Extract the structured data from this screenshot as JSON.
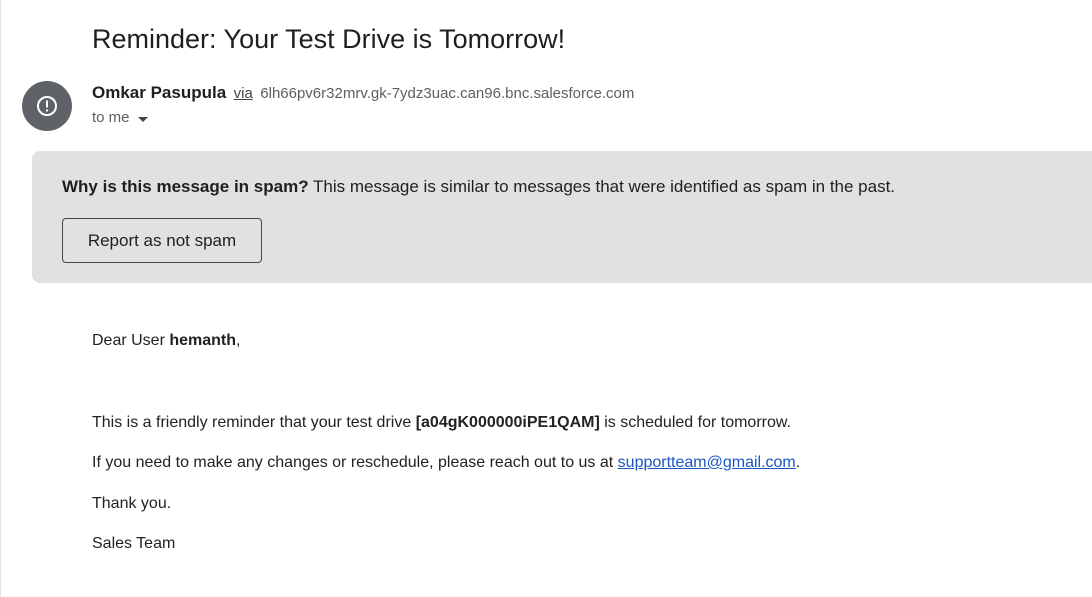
{
  "email": {
    "subject": "Reminder: Your Test Drive is Tomorrow!",
    "sender": {
      "name": "Omkar Pasupula",
      "via_label": "via",
      "domain": "6lh66pv6r32mrv.gk-7ydz3uac.can96.bnc.salesforce.com",
      "avatar_icon": "warning-exclamation-icon"
    },
    "recipient_label": "to me"
  },
  "spam_banner": {
    "question": "Why is this message in spam?",
    "explanation": "This message is similar to messages that were identified as spam in the past.",
    "button_label": "Report as not spam"
  },
  "body": {
    "greeting_prefix": "Dear User",
    "user_name": "hemanth",
    "greeting_suffix": ",",
    "p1_prefix": "This is a friendly reminder that your test drive",
    "test_drive_id": "[a04gK000000iPE1QAM]",
    "p1_suffix": "is scheduled for tomorrow.",
    "p2_prefix": "If you need to make any changes or reschedule, please reach out to us at",
    "support_email": "supportteam@gmail.com",
    "p2_suffix": ".",
    "closing": "Thank you.",
    "signature": "Sales Team"
  },
  "colors": {
    "avatar_bg": "#5f6368",
    "spam_banner_bg": "#e1e1e1",
    "link": "#1a56c4"
  }
}
